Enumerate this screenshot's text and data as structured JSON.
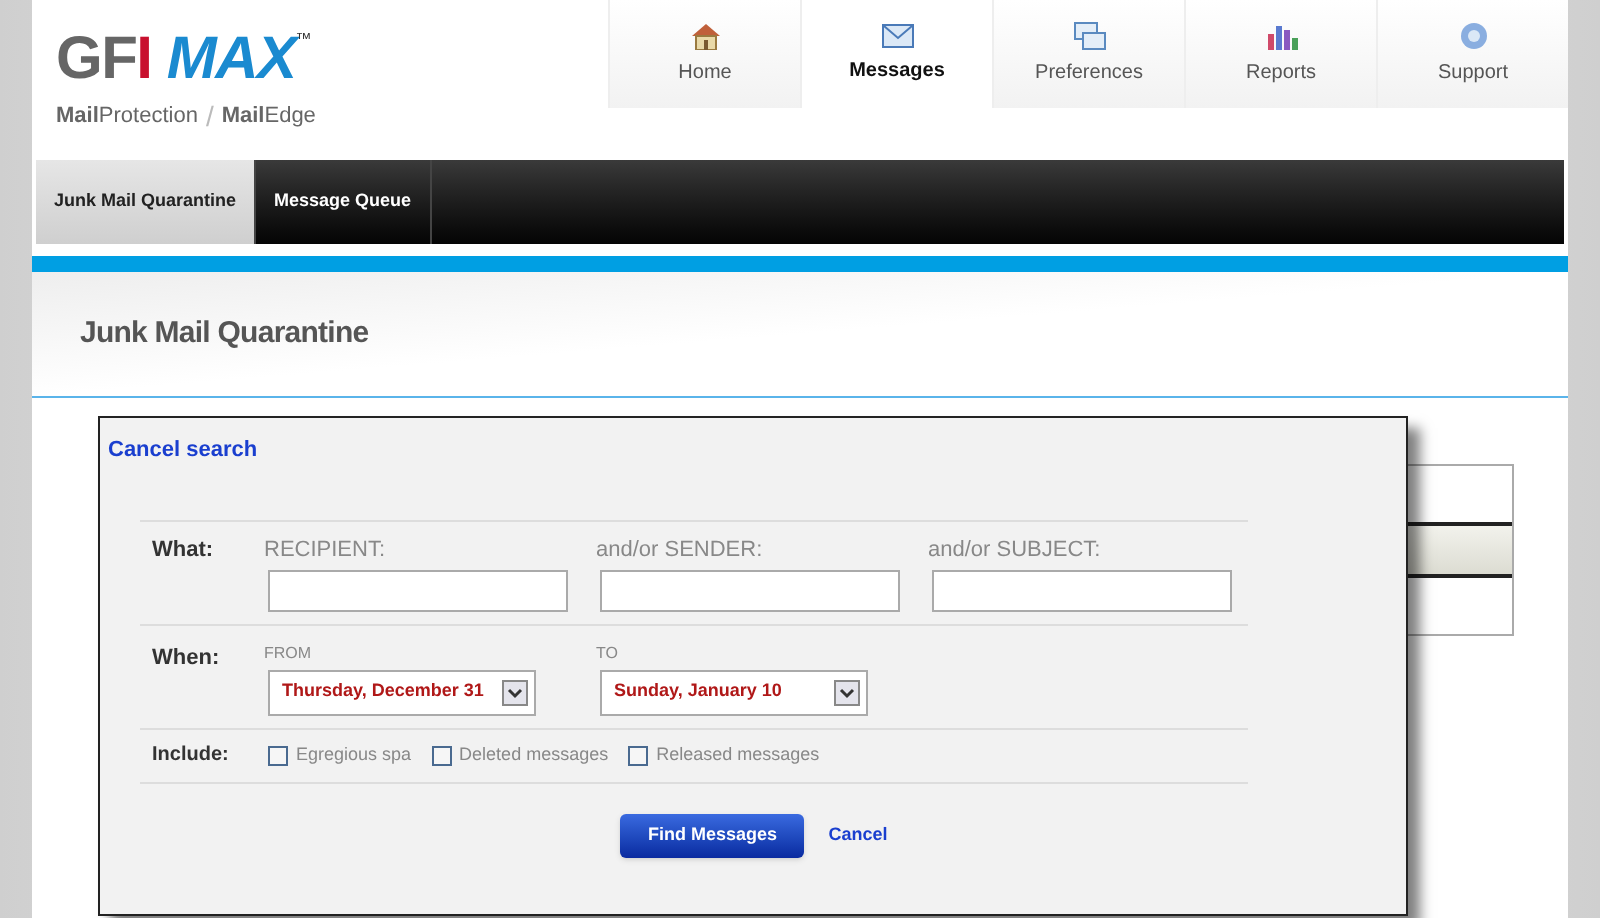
{
  "logo": {
    "brand_a": "GFI",
    "brand_b": "MAX",
    "tm": "™",
    "tagline_1": "**Mail**Protection",
    "separator": "/",
    "tagline_2": "**Mail**Edge"
  },
  "nav": [
    {
      "label": "Home",
      "kind": "home",
      "selected": false
    },
    {
      "label": "Messages",
      "kind": "mail",
      "selected": true
    },
    {
      "label": "Preferences",
      "kind": "windows",
      "selected": false
    },
    {
      "label": "Reports",
      "kind": "chart",
      "selected": false
    },
    {
      "label": "Support",
      "kind": "help",
      "selected": false
    }
  ],
  "subtabs": [
    {
      "label": "Junk Mail Quarantine",
      "selected": true
    },
    {
      "label": "Message Queue",
      "selected": false
    }
  ],
  "page_title": "Junk Mail Quarantine",
  "background_list": {
    "rows": [
      {
        "selected": false
      },
      {
        "selected": true
      },
      {
        "selected": false
      }
    ]
  },
  "search_dialog": {
    "cancel_search": "Cancel search",
    "what": {
      "label": "What:",
      "fields": [
        {
          "label": "RECIPIENT:"
        },
        {
          "label": "and/or SENDER:"
        },
        {
          "label": "and/or SUBJECT:"
        }
      ]
    },
    "when": {
      "label": "When:",
      "from_label": "FROM",
      "from": "Thursday, December 31",
      "to_label": "TO",
      "to": "Sunday, January 10"
    },
    "include": {
      "label": "Include:",
      "options": [
        {
          "label": "Egregious spa",
          "checked": false
        },
        {
          "label": "Deleted messages",
          "checked": false
        },
        {
          "label": "Released messages",
          "checked": false
        }
      ]
    },
    "find_button": "Find Messages",
    "cancel": "Cancel"
  }
}
